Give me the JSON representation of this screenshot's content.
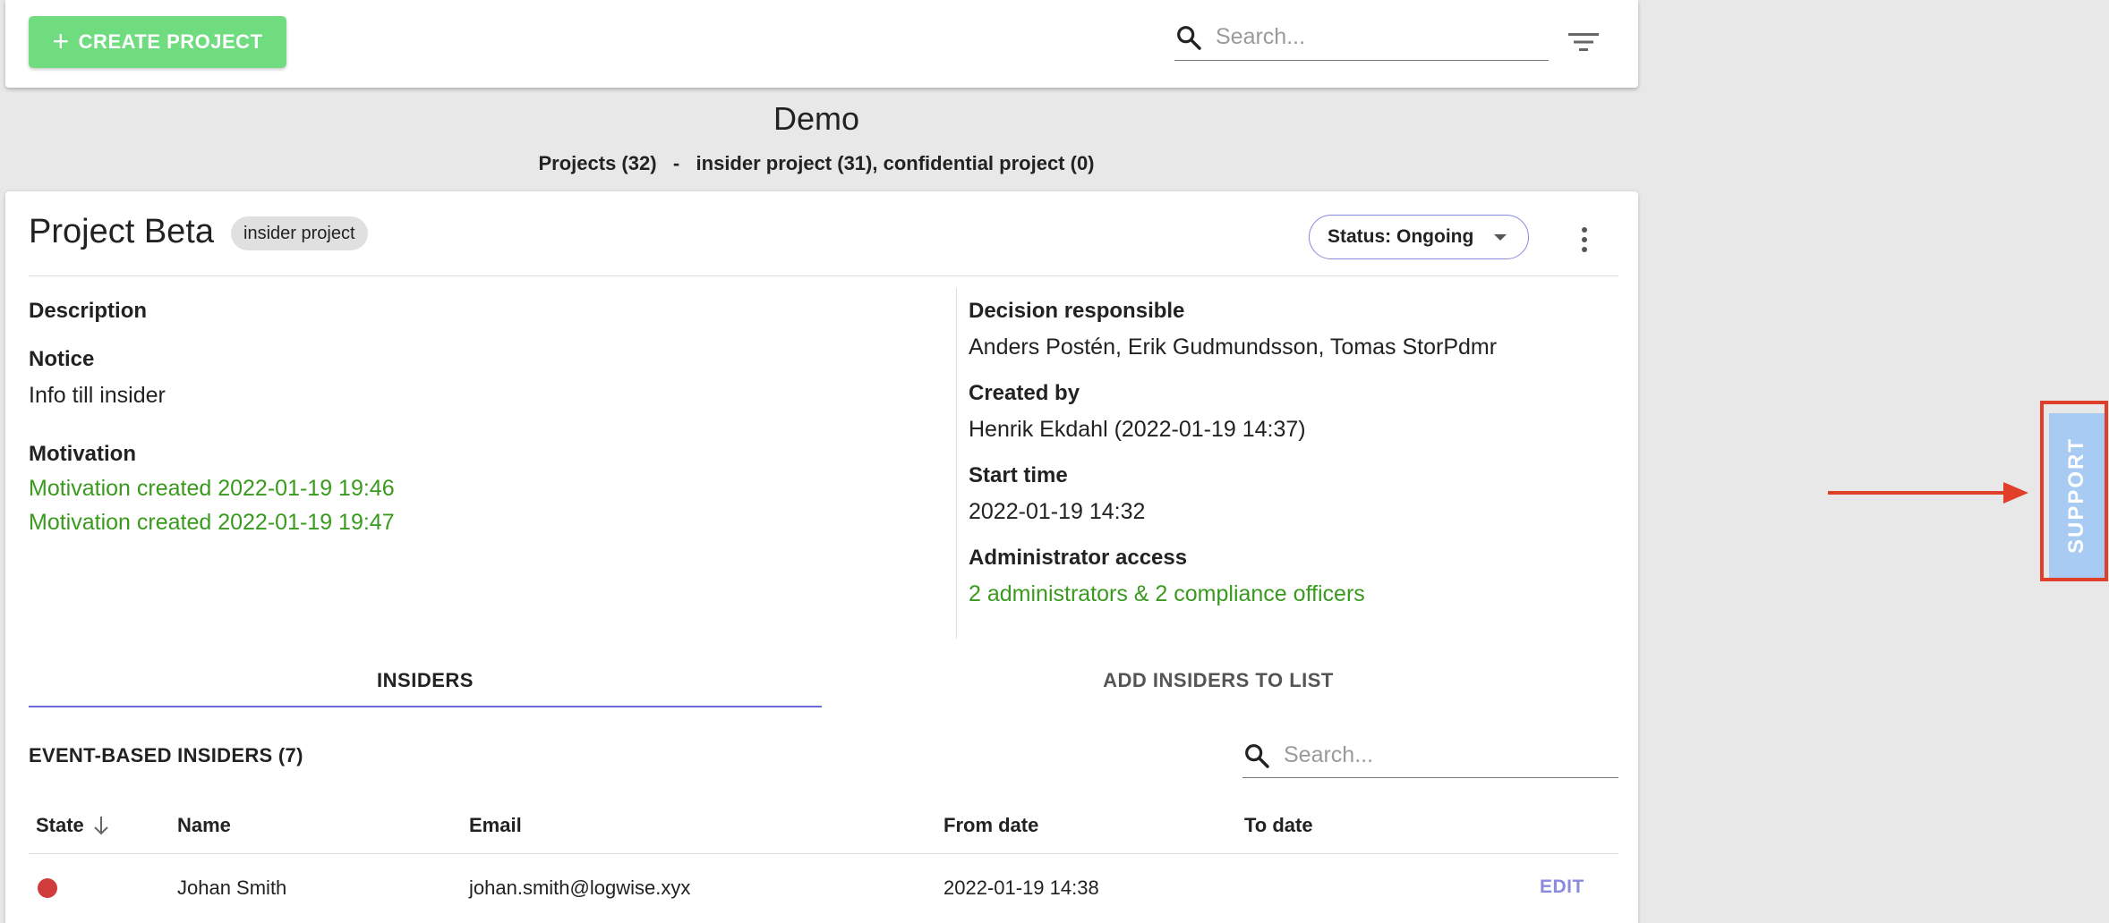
{
  "toolbar": {
    "create_label": "CREATE PROJECT",
    "search_placeholder": "Search..."
  },
  "header": {
    "title": "Demo",
    "subtitle": "Projects (32)   -   insider project (31), confidential project (0)"
  },
  "project": {
    "title": "Project Beta",
    "badge": "insider project",
    "status_label": "Status: Ongoing",
    "left": {
      "description_label": "Description",
      "notice_label": "Notice",
      "notice_value": "Info till insider",
      "motivation_label": "Motivation",
      "motivations": [
        "Motivation created 2022-01-19 19:46",
        "Motivation created 2022-01-19 19:47"
      ]
    },
    "right": {
      "decision_label": "Decision responsible",
      "decision_value": "Anders Postén, Erik Gudmundsson, Tomas StorPdmr",
      "created_label": "Created by",
      "created_value": "Henrik Ekdahl (2022-01-19 14:37)",
      "start_label": "Start time",
      "start_value": "2022-01-19 14:32",
      "admin_label": "Administrator access",
      "admin_value": "2 administrators & 2 compliance officers"
    }
  },
  "tabs": {
    "insiders": "INSIDERS",
    "add_insiders": "ADD INSIDERS TO LIST"
  },
  "insiders": {
    "section_title": "EVENT-BASED INSIDERS (7)",
    "search_placeholder": "Search...",
    "columns": [
      "State",
      "Name",
      "Email",
      "From date",
      "To date"
    ],
    "rows": [
      {
        "state_color": "#d03c3c",
        "name": "Johan Smith",
        "email": "johan.smith@logwise.xyx",
        "from_date": "2022-01-19 14:38",
        "to_date": "",
        "action": "EDIT"
      }
    ]
  },
  "support": {
    "label": "SUPPORT"
  },
  "colors": {
    "create_button": "#6fdc7f",
    "accent": "#6b6bd8",
    "link_green": "#3a9a1e",
    "annotation_red": "#e0402a",
    "support_tab": "#a7cbf3"
  }
}
